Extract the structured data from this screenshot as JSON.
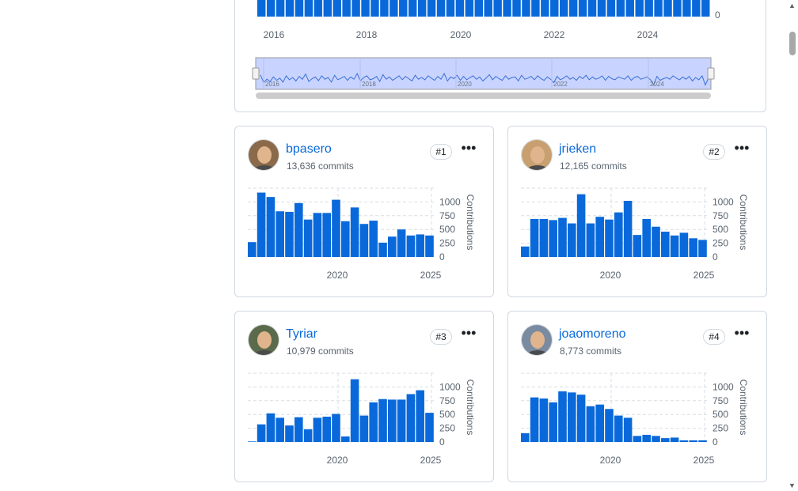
{
  "overview": {
    "x_ticks": [
      "2016",
      "2018",
      "2020",
      "2022",
      "2024"
    ],
    "y_zero": "0",
    "navigator_ticks": [
      "2016",
      "2018",
      "2020",
      "2022",
      "2024"
    ],
    "navigator_series": [
      0.55,
      0.82,
      0.7,
      0.78,
      0.62,
      0.74,
      0.66,
      0.8,
      0.58,
      0.72,
      0.64,
      0.76,
      0.6,
      0.7,
      0.52,
      0.78,
      0.68,
      0.62,
      0.75,
      0.58,
      0.7,
      0.64,
      0.8,
      0.56,
      0.72,
      0.66,
      0.6,
      0.74,
      0.62,
      0.7,
      0.5,
      0.76,
      0.64,
      0.58,
      0.72,
      0.68,
      0.6,
      0.78,
      0.54,
      0.7,
      0.62,
      0.74,
      0.66,
      0.58,
      0.72,
      0.6,
      0.68,
      0.76,
      0.56,
      0.7,
      0.64,
      0.72,
      0.58,
      0.66,
      0.74,
      0.6,
      0.7,
      0.5,
      0.76,
      0.62,
      0.68,
      0.56,
      0.74,
      0.6,
      0.72,
      0.64,
      0.58,
      0.7,
      0.62,
      0.76,
      0.66,
      0.54,
      0.72,
      0.6,
      0.68,
      0.74,
      0.58,
      0.7,
      0.64,
      0.62,
      0.76,
      0.56,
      0.7,
      0.66,
      0.6,
      0.72,
      0.58,
      0.68,
      0.74,
      0.62,
      0.7,
      0.82,
      0.6,
      0.72,
      0.66,
      0.58,
      0.7,
      0.64,
      0.74,
      0.6,
      0.68,
      0.56,
      0.72,
      0.62,
      0.7,
      0.66,
      0.58,
      0.74,
      0.6,
      0.68,
      0.72,
      0.62,
      0.66,
      0.7,
      0.58,
      0.74,
      0.64,
      0.6,
      0.7,
      0.66,
      0.62,
      0.72,
      0.9,
      0.6,
      0.74,
      0.68,
      0.64,
      0.7,
      0.58,
      0.66,
      0.72,
      0.62,
      0.7,
      0.6,
      0.76,
      0.64,
      0.72,
      0.58,
      0.9,
      0.66
    ]
  },
  "contributors": [
    {
      "login": "bpasero",
      "commits": "13,636 commits",
      "rank": "#1",
      "avatar_color": "#8a6a4a",
      "chart_data": {
        "type": "bar",
        "ylabel": "Contributions",
        "x_ticks": [
          "2020",
          "2025"
        ],
        "y_ticks": [
          "1000",
          "750",
          "500",
          "250",
          "0"
        ],
        "ylim": [
          0,
          1250
        ],
        "values": [
          270,
          1170,
          1090,
          830,
          820,
          980,
          680,
          800,
          800,
          1040,
          650,
          900,
          600,
          660,
          260,
          370,
          500,
          390,
          410,
          390
        ]
      }
    },
    {
      "login": "jrieken",
      "commits": "12,165 commits",
      "rank": "#2",
      "avatar_color": "#c8a070",
      "chart_data": {
        "type": "bar",
        "ylabel": "Contributions",
        "x_ticks": [
          "2020",
          "2025"
        ],
        "y_ticks": [
          "1000",
          "750",
          "500",
          "250",
          "0"
        ],
        "ylim": [
          0,
          1250
        ],
        "values": [
          190,
          690,
          690,
          670,
          710,
          610,
          1140,
          610,
          730,
          680,
          810,
          1020,
          400,
          690,
          550,
          460,
          390,
          440,
          340,
          310
        ]
      }
    },
    {
      "login": "Tyriar",
      "commits": "10,979 commits",
      "rank": "#3",
      "avatar_color": "#5a6a4a",
      "chart_data": {
        "type": "bar",
        "ylabel": "Contributions",
        "x_ticks": [
          "2020",
          "2025"
        ],
        "y_ticks": [
          "1000",
          "750",
          "500",
          "250",
          "0"
        ],
        "ylim": [
          0,
          1250
        ],
        "values": [
          10,
          320,
          520,
          440,
          300,
          450,
          230,
          440,
          460,
          510,
          100,
          1140,
          480,
          720,
          780,
          770,
          770,
          870,
          940,
          530
        ]
      }
    },
    {
      "login": "joaomoreno",
      "commits": "8,773 commits",
      "rank": "#4",
      "avatar_color": "#7a8aa0",
      "chart_data": {
        "type": "bar",
        "ylabel": "Contributions",
        "x_ticks": [
          "2020",
          "2025"
        ],
        "y_ticks": [
          "1000",
          "750",
          "500",
          "250",
          "0"
        ],
        "ylim": [
          0,
          1250
        ],
        "values": [
          160,
          810,
          790,
          720,
          920,
          900,
          860,
          650,
          680,
          600,
          480,
          440,
          110,
          130,
          110,
          70,
          80,
          30,
          30,
          30
        ]
      }
    }
  ],
  "colors": {
    "bar": "#0969da",
    "link": "#0969da",
    "navigator_fill": "#c8d4ff",
    "navigator_line": "#3b6fd6"
  }
}
